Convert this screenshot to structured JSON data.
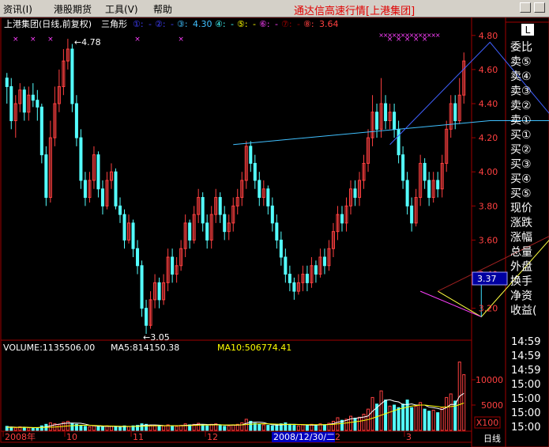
{
  "menu": {
    "items": [
      "资讯(I)",
      "港股期货",
      "工具(V)",
      "帮助"
    ],
    "title": "通达信高速行情[上港集团]"
  },
  "chart_header": {
    "stock": "上港集团(日线,前复权)",
    "indicator": "三角形",
    "params": [
      {
        "label": "①:",
        "value": "-",
        "color": "#4040ff"
      },
      {
        "label": "②:",
        "value": "-",
        "color": "#4040ff"
      },
      {
        "label": "③:",
        "value": "4.30",
        "color": "#40c0ff"
      },
      {
        "label": "④:",
        "value": "-",
        "color": "#40ffff"
      },
      {
        "label": "⑤:",
        "value": "-",
        "color": "#ffff00"
      },
      {
        "label": "⑥:",
        "value": "-",
        "color": "#ff40ff"
      },
      {
        "label": "⑦:",
        "value": "-",
        "color": "#a00000"
      },
      {
        "label": "⑧:",
        "value": "3.64",
        "color": "#ff4040"
      }
    ]
  },
  "price_axis": {
    "ticks": [
      "4.80",
      "4.60",
      "4.40",
      "4.20",
      "4.00",
      "3.80",
      "3.60",
      "3.40",
      "3.20"
    ],
    "current_price": "3.37"
  },
  "annotations": {
    "high": "4.78",
    "low": "3.05"
  },
  "volume_header": {
    "volume": "VOLUME:1135506.00",
    "ma5": "MA5:814150.38",
    "ma10": "MA10:506774.41"
  },
  "volume_axis": {
    "ticks": [
      "10000",
      "5000"
    ],
    "unit": "X100"
  },
  "date_axis": {
    "labels": [
      "2008年",
      "10",
      "11",
      "12",
      "2008/12/30/二",
      "2",
      "3"
    ],
    "period": "日线"
  },
  "side_panel": {
    "badge": "L",
    "items": [
      "委比",
      "卖⑤",
      "卖④",
      "卖③",
      "卖②",
      "卖①",
      "买①",
      "买②",
      "买③",
      "买④",
      "买⑤",
      "现价",
      "涨跌",
      "涨幅",
      "总量",
      "外盘",
      "换手",
      "净资",
      "收益("
    ],
    "times": [
      "14:59",
      "14:59",
      "14:59",
      "15:00",
      "15:00",
      "15:00",
      "15:00"
    ]
  },
  "colors": {
    "up": "#ff4040",
    "down": "#54ffff",
    "axis": "#a00000",
    "ma5": "#ffffff",
    "ma10": "#ffff00"
  },
  "chart_data": {
    "type": "candlestick",
    "title": "上港集团(日线,前复权)",
    "ylim": [
      3.05,
      4.85
    ],
    "price_extremes": {
      "high": 4.78,
      "low": 3.05
    },
    "candles": [
      [
        4.55,
        4.5,
        4.58,
        4.4
      ],
      [
        4.5,
        4.3,
        4.55,
        4.25
      ],
      [
        4.3,
        4.4,
        4.45,
        4.2
      ],
      [
        4.4,
        4.48,
        4.52,
        4.35
      ],
      [
        4.48,
        4.35,
        4.5,
        4.3
      ],
      [
        4.35,
        4.45,
        4.5,
        4.3
      ],
      [
        4.45,
        4.42,
        4.52,
        4.38
      ],
      [
        4.42,
        4.38,
        4.48,
        4.3
      ],
      [
        4.38,
        4.1,
        4.4,
        4.05
      ],
      [
        4.1,
        3.85,
        4.15,
        3.8
      ],
      [
        3.85,
        4.2,
        4.3,
        3.82
      ],
      [
        4.2,
        4.4,
        4.5,
        4.15
      ],
      [
        4.4,
        4.5,
        4.6,
        4.35
      ],
      [
        4.5,
        4.65,
        4.72,
        4.45
      ],
      [
        4.65,
        4.72,
        4.78,
        4.6
      ],
      [
        4.72,
        4.4,
        4.75,
        4.35
      ],
      [
        4.4,
        4.2,
        4.45,
        4.15
      ],
      [
        4.2,
        3.95,
        4.25,
        3.9
      ],
      [
        3.95,
        3.85,
        4.0,
        3.8
      ],
      [
        3.85,
        3.95,
        4.0,
        3.82
      ],
      [
        3.95,
        4.1,
        4.15,
        3.9
      ],
      [
        4.1,
        3.9,
        4.12,
        3.85
      ],
      [
        3.9,
        3.8,
        3.95,
        3.75
      ],
      [
        3.8,
        3.95,
        4.0,
        3.78
      ],
      [
        3.95,
        4.0,
        4.05,
        3.9
      ],
      [
        4.0,
        3.8,
        4.02,
        3.78
      ],
      [
        3.8,
        3.75,
        3.85,
        3.7
      ],
      [
        3.75,
        3.6,
        3.78,
        3.55
      ],
      [
        3.6,
        3.7,
        3.75,
        3.58
      ],
      [
        3.7,
        3.55,
        3.72,
        3.5
      ],
      [
        3.55,
        3.45,
        3.6,
        3.4
      ],
      [
        3.45,
        3.2,
        3.48,
        3.15
      ],
      [
        3.2,
        3.1,
        3.25,
        3.05
      ],
      [
        3.1,
        3.25,
        3.3,
        3.08
      ],
      [
        3.25,
        3.35,
        3.4,
        3.2
      ],
      [
        3.35,
        3.25,
        3.38,
        3.2
      ],
      [
        3.25,
        3.35,
        3.4,
        3.22
      ],
      [
        3.35,
        3.5,
        3.55,
        3.3
      ],
      [
        3.5,
        3.4,
        3.55,
        3.35
      ],
      [
        3.4,
        3.45,
        3.5,
        3.35
      ],
      [
        3.45,
        3.55,
        3.6,
        3.42
      ],
      [
        3.55,
        3.7,
        3.75,
        3.5
      ],
      [
        3.7,
        3.6,
        3.72,
        3.55
      ],
      [
        3.6,
        3.75,
        3.8,
        3.58
      ],
      [
        3.75,
        3.85,
        3.9,
        3.7
      ],
      [
        3.85,
        3.7,
        3.88,
        3.65
      ],
      [
        3.7,
        3.6,
        3.75,
        3.55
      ],
      [
        3.6,
        3.75,
        3.8,
        3.55
      ],
      [
        3.75,
        3.85,
        3.9,
        3.7
      ],
      [
        3.85,
        3.75,
        3.88,
        3.7
      ],
      [
        3.75,
        3.65,
        3.8,
        3.6
      ],
      [
        3.65,
        3.7,
        3.75,
        3.6
      ],
      [
        3.7,
        3.8,
        3.85,
        3.65
      ],
      [
        3.8,
        3.85,
        3.9,
        3.75
      ],
      [
        3.85,
        3.95,
        4.0,
        3.8
      ],
      [
        3.95,
        4.15,
        4.18,
        3.9
      ],
      [
        4.15,
        4.05,
        4.18,
        4.0
      ],
      [
        4.05,
        3.95,
        4.1,
        3.9
      ],
      [
        3.95,
        3.85,
        4.0,
        3.8
      ],
      [
        3.85,
        3.9,
        3.95,
        3.8
      ],
      [
        3.9,
        3.8,
        3.92,
        3.75
      ],
      [
        3.8,
        3.7,
        3.85,
        3.65
      ],
      [
        3.7,
        3.6,
        3.75,
        3.55
      ],
      [
        3.6,
        3.5,
        3.65,
        3.45
      ],
      [
        3.5,
        3.4,
        3.55,
        3.35
      ],
      [
        3.4,
        3.35,
        3.45,
        3.3
      ],
      [
        3.35,
        3.3,
        3.38,
        3.25
      ],
      [
        3.3,
        3.35,
        3.4,
        3.28
      ],
      [
        3.35,
        3.4,
        3.45,
        3.3
      ],
      [
        3.4,
        3.35,
        3.45,
        3.3
      ],
      [
        3.35,
        3.45,
        3.5,
        3.32
      ],
      [
        3.45,
        3.4,
        3.48,
        3.35
      ],
      [
        3.4,
        3.5,
        3.55,
        3.38
      ],
      [
        3.5,
        3.45,
        3.55,
        3.4
      ],
      [
        3.45,
        3.55,
        3.6,
        3.42
      ],
      [
        3.55,
        3.65,
        3.7,
        3.5
      ],
      [
        3.65,
        3.75,
        3.8,
        3.6
      ],
      [
        3.75,
        3.7,
        3.8,
        3.65
      ],
      [
        3.7,
        3.8,
        3.85,
        3.65
      ],
      [
        3.8,
        3.9,
        3.95,
        3.75
      ],
      [
        3.9,
        3.85,
        3.95,
        3.8
      ],
      [
        3.85,
        3.95,
        4.0,
        3.8
      ],
      [
        3.95,
        4.05,
        4.1,
        3.9
      ],
      [
        4.05,
        4.2,
        4.25,
        4.0
      ],
      [
        4.2,
        4.35,
        4.45,
        4.15
      ],
      [
        4.35,
        4.25,
        4.4,
        4.2
      ],
      [
        4.25,
        4.4,
        4.55,
        4.2
      ],
      [
        4.4,
        4.3,
        4.45,
        4.25
      ],
      [
        4.3,
        4.35,
        4.4,
        4.25
      ],
      [
        4.35,
        4.25,
        4.4,
        4.2
      ],
      [
        4.25,
        4.1,
        4.3,
        4.05
      ],
      [
        4.1,
        3.95,
        4.15,
        3.9
      ],
      [
        3.95,
        3.8,
        4.0,
        3.75
      ],
      [
        3.8,
        3.7,
        3.85,
        3.65
      ],
      [
        3.7,
        3.85,
        3.9,
        3.68
      ],
      [
        3.85,
        4.05,
        4.1,
        3.8
      ],
      [
        4.05,
        3.95,
        4.08,
        3.9
      ],
      [
        3.95,
        3.85,
        4.0,
        3.8
      ],
      [
        3.85,
        3.95,
        4.0,
        3.82
      ],
      [
        3.95,
        3.9,
        4.0,
        3.85
      ],
      [
        3.9,
        4.05,
        4.1,
        3.85
      ],
      [
        4.05,
        4.25,
        4.3,
        4.0
      ],
      [
        4.25,
        4.4,
        4.45,
        4.2
      ],
      [
        4.4,
        4.3,
        4.45,
        4.25
      ],
      [
        4.3,
        4.45,
        4.55,
        4.28
      ],
      [
        4.45,
        4.65,
        4.7,
        4.4
      ]
    ],
    "volumes": [
      800,
      600,
      500,
      700,
      600,
      500,
      400,
      500,
      900,
      1200,
      1500,
      1300,
      1100,
      1600,
      1800,
      1400,
      1200,
      1000,
      800,
      700,
      900,
      800,
      700,
      900,
      800,
      700,
      600,
      900,
      800,
      900,
      1000,
      1300,
      1200,
      1000,
      900,
      800,
      900,
      1100,
      900,
      800,
      1000,
      1300,
      1100,
      1200,
      1400,
      1100,
      900,
      1200,
      1300,
      1000,
      800,
      900,
      1100,
      1200,
      1500,
      2200,
      1800,
      1400,
      1200,
      1100,
      1000,
      900,
      1100,
      1300,
      1500,
      1200,
      1000,
      900,
      1100,
      1000,
      1200,
      1000,
      1300,
      1100,
      1400,
      1800,
      2500,
      2000,
      2200,
      2800,
      2400,
      2600,
      3200,
      4200,
      6500,
      5200,
      7800,
      6000,
      4800,
      5000,
      4500,
      5200,
      6000,
      4500,
      4800,
      5500,
      4200,
      3800,
      4000,
      3500,
      4500,
      6500,
      7200,
      5800,
      13500,
      11000
    ],
    "ma5": [
      650,
      680,
      620,
      600,
      640,
      580,
      540,
      540,
      600,
      700,
      900,
      1100,
      1240,
      1340,
      1460,
      1440,
      1420,
      1400,
      1240,
      1020,
      920,
      840,
      820,
      800,
      820,
      800,
      740,
      740,
      760,
      780,
      840,
      960,
      1040,
      1080,
      1080,
      1040,
      960,
      940,
      940,
      940,
      960,
      1020,
      1040,
      1120,
      1200,
      1220,
      1180,
      1160,
      1180,
      1140,
      1040,
      1040,
      1060,
      1040,
      1100,
      1380,
      1560,
      1620,
      1620,
      1540,
      1300,
      1120,
      1060,
      1080,
      1160,
      1200,
      1220,
      1180,
      1140,
      1080,
      1040,
      1040,
      1120,
      1120,
      1200,
      1320,
      1620,
      1760,
      1980,
      2260,
      2380,
      2500,
      2640,
      2840,
      3780,
      4500,
      5280,
      5940,
      6060,
      5760,
      5620,
      5100,
      5100,
      5240,
      5000,
      5000,
      5000,
      4600,
      4500,
      4340,
      4100,
      4500,
      5140,
      5120,
      6740,
      7320
    ],
    "ma10": [
      600,
      610,
      600,
      590,
      600,
      590,
      570,
      560,
      580,
      600,
      620,
      660,
      720,
      800,
      870,
      940,
      980,
      1010,
      1020,
      1000,
      970,
      940,
      900,
      880,
      860,
      840,
      820,
      800,
      790,
      790,
      800,
      820,
      860,
      900,
      920,
      920,
      920,
      920,
      920,
      920,
      920,
      940,
      960,
      1000,
      1040,
      1060,
      1060,
      1080,
      1100,
      1100,
      1080,
      1080,
      1080,
      1080,
      1100,
      1150,
      1220,
      1260,
      1280,
      1300,
      1280,
      1260,
      1240,
      1220,
      1200,
      1200,
      1180,
      1160,
      1150,
      1140,
      1140,
      1130,
      1140,
      1140,
      1160,
      1200,
      1280,
      1360,
      1460,
      1580,
      1700,
      1820,
      1960,
      2140,
      2400,
      2700,
      3000,
      3300,
      3600,
      3900,
      4200,
      4400,
      4600,
      4800,
      4900,
      5000,
      5000,
      4900,
      4800,
      4700,
      4600,
      4600,
      4700,
      4800,
      5100,
      5400
    ],
    "pattern_lines": [
      {
        "points": [
          [
            0,
            4.16
          ],
          [
            59,
            4.3
          ],
          [
            74,
            4.3
          ]
        ],
        "color": "#40c0ff"
      },
      {
        "points": [
          [
            36,
            4.16
          ],
          [
            59,
            4.76
          ],
          [
            74,
            4.3
          ]
        ],
        "color": "#4060ff"
      },
      {
        "points": [
          [
            47,
            3.3
          ],
          [
            57,
            3.15
          ],
          [
            74,
            3.64
          ]
        ],
        "color": "#ffff40"
      },
      {
        "points": [
          [
            47,
            3.3
          ],
          [
            74,
            3.64
          ]
        ],
        "color": "#a02020"
      },
      {
        "points": [
          [
            74,
            3.64
          ],
          [
            80,
            3.64
          ]
        ],
        "color": "#c03030"
      },
      {
        "points": [
          [
            43,
            3.3
          ],
          [
            57,
            3.15
          ]
        ],
        "color": "#ff40ff"
      },
      {
        "points": [
          [
            57,
            3.15
          ],
          [
            57,
            3.4
          ]
        ],
        "color": "#40e0ff"
      }
    ]
  }
}
